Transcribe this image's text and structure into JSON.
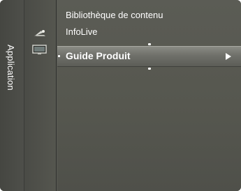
{
  "sidebar": {
    "tab_label": "Application",
    "icons": [
      "satellite-dish-icon",
      "monitor-screen-icon"
    ]
  },
  "menu": {
    "items": [
      {
        "label": "Bibliothèque de contenu"
      },
      {
        "label": "InfoLive"
      },
      {
        "label": "Guide Produit",
        "selected": true,
        "has_submenu": true
      }
    ]
  },
  "colors": {
    "panel_background": "#5a5b55",
    "highlight_top": "#8a8b84",
    "highlight_bottom": "#5c5d57",
    "text": "#ffffff"
  }
}
